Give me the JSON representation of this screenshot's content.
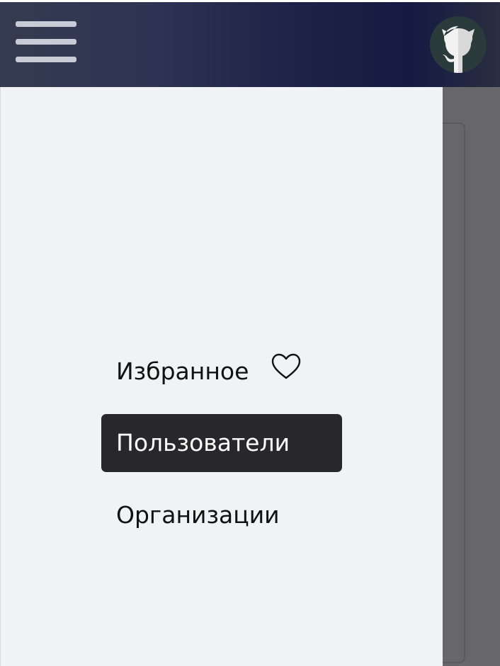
{
  "header": {
    "menu_icon": "hamburger-menu-icon",
    "avatar_icon": "github-octocat-icon",
    "gradient_colors": [
      "#353b50",
      "#1e2247",
      "#141a42"
    ]
  },
  "drawer": {
    "background": "#f1f2f5",
    "items": [
      {
        "label": "Избранное",
        "icon": "heart-outline-icon",
        "active": false
      },
      {
        "label": "Пользователи",
        "active": true
      },
      {
        "label": "Организации",
        "active": false
      }
    ],
    "active_color": "#27272c"
  },
  "backdrop": {
    "color": "#67666b"
  }
}
